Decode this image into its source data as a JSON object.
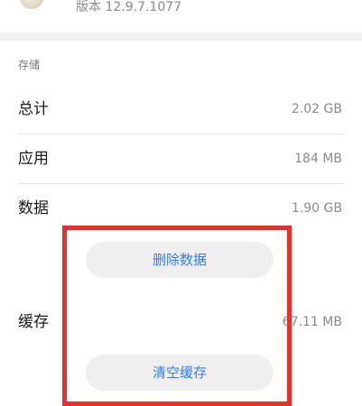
{
  "app": {
    "version_text": "版本 12.9.7.1077"
  },
  "storage": {
    "section_title": "存储",
    "rows": [
      {
        "label": "总计",
        "value": "2.02 GB"
      },
      {
        "label": "应用",
        "value": "184 MB"
      },
      {
        "label": "数据",
        "value": "1.90 GB"
      }
    ],
    "clear_data_label": "删除数据",
    "cache": {
      "label": "缓存",
      "value": "67.11 MB"
    },
    "clear_cache_label": "清空缓存"
  },
  "colors": {
    "accent": "#2e7ff0",
    "highlight": "#e53030"
  }
}
